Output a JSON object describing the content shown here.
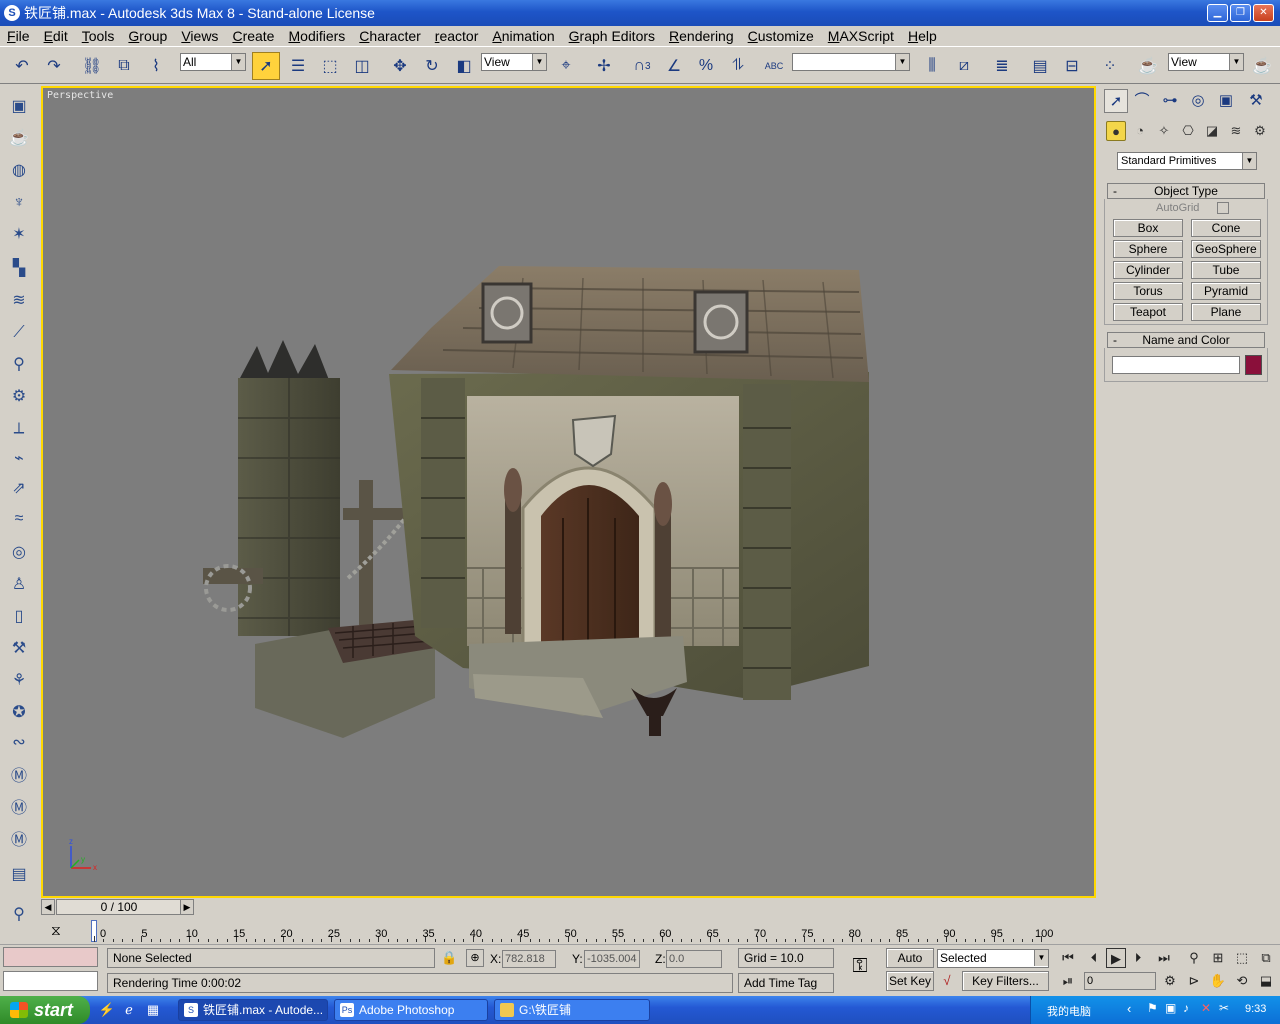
{
  "window": {
    "title": "铁匠铺.max - Autodesk 3ds Max 8  - Stand-alone License",
    "buttons": [
      "minimize",
      "maximize",
      "close"
    ]
  },
  "menu": [
    "File",
    "Edit",
    "Tools",
    "Group",
    "Views",
    "Create",
    "Modifiers",
    "Character",
    "reactor",
    "Animation",
    "Graph Editors",
    "Rendering",
    "Customize",
    "MAXScript",
    "Help"
  ],
  "toolbar": {
    "selection_filter": "All",
    "ref_coord_left": "View",
    "named_selection": "",
    "ref_coord_right": "View",
    "snap_label": "3",
    "text_tool": "ABC"
  },
  "viewport": {
    "label": "Perspective",
    "axis": {
      "x": "x",
      "y": "y",
      "z": "z"
    },
    "background": "#7d7d7d",
    "active_border": "#ffd800"
  },
  "command_panel": {
    "category": "Standard Primitives",
    "object_type": {
      "header": "Object Type",
      "autogrid": "AutoGrid",
      "buttons": [
        "Box",
        "Cone",
        "Sphere",
        "GeoSphere",
        "Cylinder",
        "Tube",
        "Torus",
        "Pyramid",
        "Teapot",
        "Plane"
      ]
    },
    "name_and_color": {
      "header": "Name and Color",
      "name_value": "",
      "color": "#8a0f3a"
    }
  },
  "timeline": {
    "slider": "0 / 100",
    "ruler_labels": [
      "0",
      "5",
      "10",
      "15",
      "20",
      "25",
      "30",
      "35",
      "40",
      "45",
      "50",
      "55",
      "60",
      "65",
      "70",
      "75",
      "80",
      "85",
      "90",
      "95",
      "100"
    ]
  },
  "status": {
    "selection": "None Selected",
    "prompt": "Rendering Time  0:00:02",
    "x_label": "X:",
    "x_value": "782.818",
    "y_label": "Y:",
    "y_value": "-1035.004",
    "z_label": "Z:",
    "z_value": "0.0",
    "grid": "Grid = 10.0",
    "add_time_tag": "Add Time Tag",
    "auto_key": "Auto Key",
    "set_key": "Set Key",
    "key_mode": "Selected",
    "key_filters": "Key Filters...",
    "current_frame": "0"
  },
  "taskbar": {
    "start": "start",
    "tasks": [
      {
        "label": "铁匠铺.max - Autode...",
        "active": true
      },
      {
        "label": "Adobe Photoshop",
        "active": false
      },
      {
        "label": "G:\\铁匠铺",
        "active": false
      }
    ],
    "tray_text": "我的电脑",
    "clock": "9:33"
  }
}
